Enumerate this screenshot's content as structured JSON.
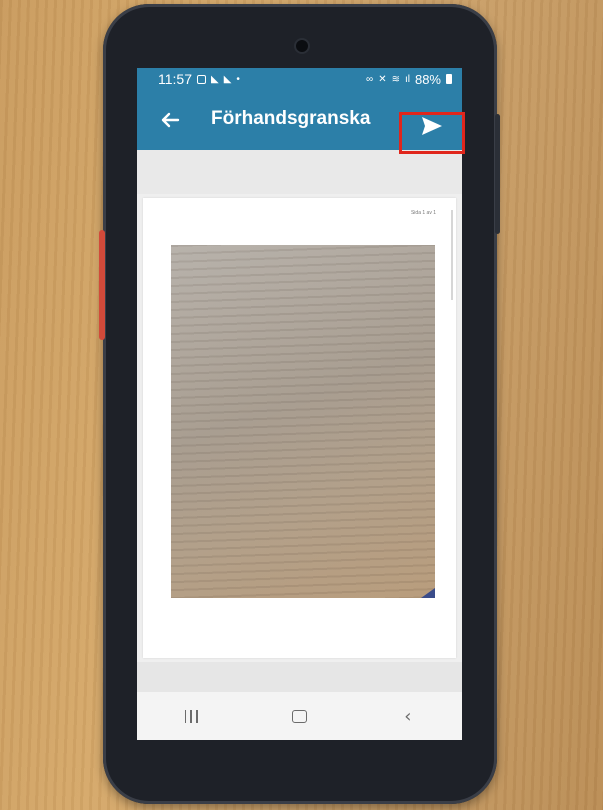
{
  "status_bar": {
    "time": "11:57",
    "battery": "88%",
    "icons": [
      "notification-icon",
      "signal-icon",
      "signal-icon",
      "dot-icon",
      "link-icon",
      "mute-icon",
      "wifi-icon",
      "cellular-icon",
      "battery-icon"
    ]
  },
  "app_bar": {
    "title": "Förhandsgranska",
    "back_icon": "arrow-left-icon",
    "send_icon": "send-icon"
  },
  "preview": {
    "page_counter": "Sida 1 av 1"
  },
  "nav_bar": {
    "buttons": [
      "recents-icon",
      "home-icon",
      "back-icon"
    ]
  },
  "colors": {
    "accent": "#2c7fa8",
    "highlight": "#e0261c"
  }
}
